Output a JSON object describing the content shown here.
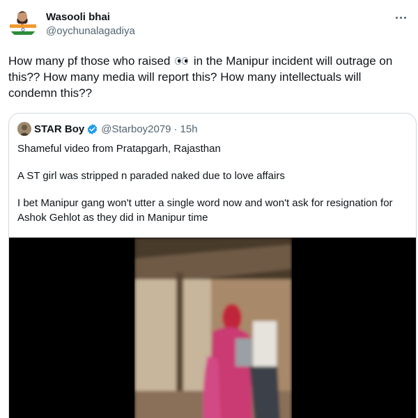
{
  "tweet": {
    "author": {
      "display_name": "Wasooli bhai",
      "handle": "@oychunalagadiya",
      "avatar_icon": "avatar-with-flag-icon"
    },
    "more_icon": "more-options-icon",
    "text_before_emoji": "How many pf those who raised ",
    "emoji_icon": "eyes-emoji-icon",
    "text_after_emoji": " in the Manipur incident will outrage on this?? How many media will report this? How many intellectuals will condemn this??"
  },
  "quoted_tweet": {
    "author": {
      "display_name": "STAR Boy",
      "verified_icon": "verified-badge-icon",
      "handle": "@Starboy2079",
      "separator": "·",
      "time": "15h"
    },
    "paragraphs": [
      "Shameful video from Pratapgarh, Rajasthan",
      "A ST girl was stripped n paraded naked due to love affairs",
      "I bet Manipur gang won't utter a single word now and won't ask for resignation for Ashok Gehlot as they did in Manipur time"
    ],
    "media": {
      "type": "video-thumbnail"
    }
  },
  "colors": {
    "text_primary": "#0f1419",
    "text_secondary": "#536471",
    "border": "#cfd9de",
    "verified_blue": "#1d9bf0",
    "media_background": "#000000"
  }
}
